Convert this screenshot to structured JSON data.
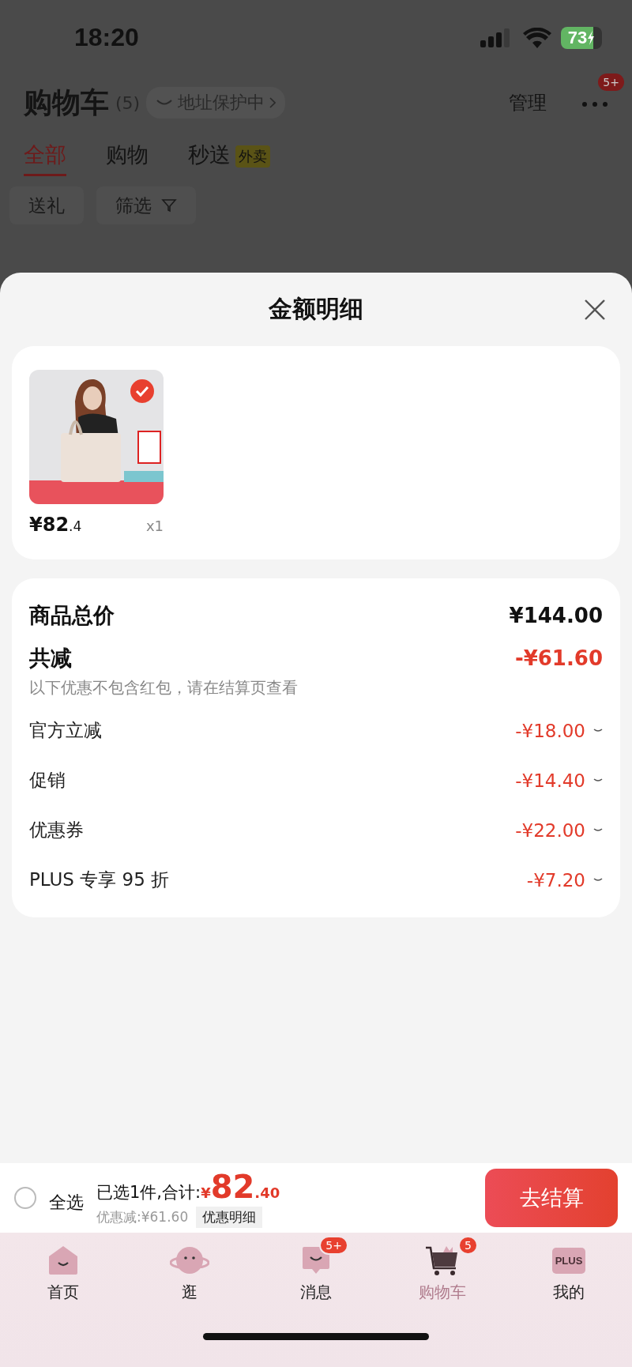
{
  "status_bar": {
    "time": "18:20",
    "battery": "73"
  },
  "header": {
    "title": "购物车",
    "count": "(5)",
    "address_pill": "地址保护中",
    "manage": "管理",
    "more_badge": "5+"
  },
  "tabs": [
    {
      "label": "全部",
      "selected": true
    },
    {
      "label": "购物",
      "selected": false
    },
    {
      "label": "秒送",
      "selected": false,
      "tag": "外卖"
    }
  ],
  "chips": [
    {
      "label": "送礼",
      "kind": "plain"
    },
    {
      "label": "筛选",
      "kind": "filter"
    }
  ],
  "sheet": {
    "title": "金额明细",
    "product": {
      "kind": "picture",
      "selected": true,
      "price": "¥82",
      "price_decimal": ".4",
      "quantity": "x1"
    },
    "summary": [
      {
        "kind": "total",
        "label": "商品总价",
        "amount": "¥144.00"
      },
      {
        "kind": "reduction",
        "label": "共减",
        "amount": "-¥61.60",
        "note": "以下优惠不包含红包，请在结算页查看"
      },
      {
        "kind": "discount",
        "label": "官方立减",
        "amount": "-¥18.00"
      },
      {
        "kind": "discount",
        "label": "促销",
        "amount": "-¥14.40"
      },
      {
        "kind": "discount",
        "label": "优惠券",
        "amount": "-¥22.00"
      },
      {
        "kind": "discount",
        "label": "PLUS 专享 95 折",
        "amount": "-¥7.20"
      }
    ]
  },
  "checkout_bar": {
    "select_all": {
      "label": "全选",
      "checked": false
    },
    "selected_text": "已选1件,合计:",
    "currency": "¥",
    "total": "82",
    "total_decimal": ".40",
    "discount_text": "优惠减:¥61.60",
    "detail_button": "优惠明细",
    "checkout_button": "去结算"
  },
  "tab_bar": [
    {
      "kind": "home",
      "label": "首页",
      "selected": false
    },
    {
      "kind": "planet",
      "label": "逛",
      "selected": false
    },
    {
      "kind": "message",
      "label": "消息",
      "selected": false,
      "badge": "5+"
    },
    {
      "kind": "cart",
      "label": "购物车",
      "selected": true,
      "badge": "5"
    },
    {
      "kind": "plus",
      "label": "我的",
      "selected": false,
      "icon_text": "PLUS"
    }
  ]
}
